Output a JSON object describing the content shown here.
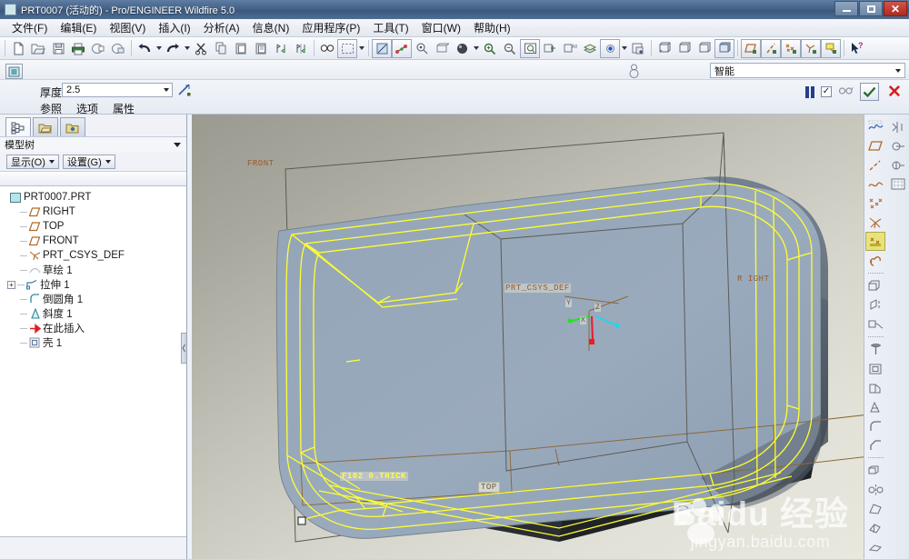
{
  "window": {
    "title": "PRT0007 (活动的) - Pro/ENGINEER Wildfire 5.0",
    "icon": "part-icon",
    "minimize": "—",
    "maximize": "□",
    "close": "✕"
  },
  "menubar": {
    "items": [
      {
        "label": "文件(F)",
        "name": "menu-file"
      },
      {
        "label": "编辑(E)",
        "name": "menu-edit"
      },
      {
        "label": "视图(V)",
        "name": "menu-view"
      },
      {
        "label": "插入(I)",
        "name": "menu-insert"
      },
      {
        "label": "分析(A)",
        "name": "menu-analysis"
      },
      {
        "label": "信息(N)",
        "name": "menu-info"
      },
      {
        "label": "应用程序(P)",
        "name": "menu-applications"
      },
      {
        "label": "工具(T)",
        "name": "menu-tools"
      },
      {
        "label": "窗口(W)",
        "name": "menu-window"
      },
      {
        "label": "帮助(H)",
        "name": "menu-help"
      }
    ]
  },
  "toolbar": {
    "items": [
      "new-file-icon",
      "open-file-icon",
      "save-icon",
      "print-icon",
      "mail-icon",
      "mail-review-icon",
      "undo-icon",
      "redo-icon",
      "cut-icon",
      "copy-icon",
      "paste-icon",
      "paste-special-icon",
      "regenerate-icon",
      "regenerate-all-icon",
      "find-icon",
      "select-box-icon",
      "sketcher-icon",
      "datum-display-icon",
      "spin-center-icon",
      "reorient-icon",
      "shading-icon",
      "zoom-in-icon",
      "zoom-out-icon",
      "refit-icon",
      "layer-icon",
      "annotation-icon",
      "appearance-icon",
      "light-icon",
      "saved-view-icon",
      "wireframe-icon",
      "hidden-line-icon",
      "no-hidden-icon",
      "shaded-icon",
      "datum-plane-toggle-icon",
      "datum-axis-toggle-icon",
      "datum-point-toggle-icon",
      "datum-csys-toggle-icon",
      "annotation-toggle-icon",
      "context-help-icon"
    ]
  },
  "filter": {
    "label_icon": "spin-center-icon",
    "value": "智能",
    "name": "selection-filter"
  },
  "dashboard": {
    "feature_icon": "shell-feature-icon",
    "thickness_label": "厚度",
    "thickness_value": "2.5",
    "flip_icon": "flip-direction-icon",
    "tabs": [
      {
        "label": "参照",
        "name": "dashboard-tab-references"
      },
      {
        "label": "选项",
        "name": "dashboard-tab-options"
      },
      {
        "label": "属性",
        "name": "dashboard-tab-properties"
      }
    ],
    "actions": {
      "pause": "pause-icon",
      "preview_checked": "✓",
      "preview_icon": "glasses-preview-icon",
      "confirm": "✓",
      "cancel": "✕"
    }
  },
  "left_panel": {
    "tabs": [
      {
        "name": "tab-model-tree",
        "icon": "model-tree-icon",
        "active": true
      },
      {
        "name": "tab-folder-browser",
        "icon": "folder-browser-icon",
        "active": false
      },
      {
        "name": "tab-favorites",
        "icon": "favorites-folder-icon",
        "active": false
      }
    ],
    "title": "模型树",
    "buttons": [
      {
        "label": "显示(O)",
        "name": "tree-show-button"
      },
      {
        "label": "设置(G)",
        "name": "tree-settings-button"
      }
    ],
    "tree": [
      {
        "label": "PRT0007.PRT",
        "icon": "part-icon",
        "depth": 0,
        "expand": ""
      },
      {
        "label": "RIGHT",
        "icon": "datum-plane-icon",
        "depth": 1,
        "expand": ""
      },
      {
        "label": "TOP",
        "icon": "datum-plane-icon",
        "depth": 1,
        "expand": ""
      },
      {
        "label": "FRONT",
        "icon": "datum-plane-icon",
        "depth": 1,
        "expand": ""
      },
      {
        "label": "PRT_CSYS_DEF",
        "icon": "datum-csys-icon",
        "depth": 1,
        "expand": ""
      },
      {
        "label": "草绘 1",
        "icon": "sketch-icon",
        "depth": 1,
        "expand": ""
      },
      {
        "label": "拉伸 1",
        "icon": "extrude-icon",
        "depth": 1,
        "expand": "+"
      },
      {
        "label": "倒圆角 1",
        "icon": "round-icon",
        "depth": 1,
        "expand": ""
      },
      {
        "label": "斜度 1",
        "icon": "draft-icon",
        "depth": 1,
        "expand": ""
      },
      {
        "label": "在此插入",
        "icon": "insert-here-icon",
        "depth": 1,
        "expand": ""
      },
      {
        "label": "壳 1",
        "icon": "shell-icon",
        "depth": 1,
        "expand": ""
      }
    ]
  },
  "viewport": {
    "labels": {
      "front_plane": "FRONT",
      "right_plane": "R IGHT",
      "top_plane": "TOP",
      "csys": "PRT_CSYS_DEF",
      "axis_x": "X",
      "axis_y": "Y",
      "axis_z": "Z",
      "dimension": "F102 0.THICK"
    },
    "colors": {
      "preview_wireframe": "#ffff2e",
      "datum_plane": "#8a6a3a",
      "model_surface": "#8fa0b4",
      "model_dark": "#2a2d33",
      "axis_x": "#e61f1f",
      "axis_y": "#1fe61f",
      "axis_z": "#1fd8e6"
    }
  },
  "watermark": {
    "main": "Baidu 经验",
    "sub": "jingyan.baidu.com"
  },
  "right_toolbar": {
    "column_a": [
      "sketch-tool-icon",
      "datum-plane-tool-icon",
      "datum-axis-tool-icon",
      "datum-curve-tool-icon",
      "datum-point-tool-icon",
      "datum-coord-sys-tool-icon",
      "datum-point-offset-icon",
      "datum-ref-icon",
      "extrude-tool-icon",
      "revolve-tool-icon",
      "sweep-tool-icon",
      "hole-tool-icon",
      "shell-tool-icon",
      "rib-tool-icon",
      "draft-tool-icon",
      "round-tool-icon",
      "chamfer-tool-icon",
      "pattern-tool-icon",
      "mirror-tool-icon",
      "trim-tool-icon",
      "merge-tool-icon",
      "offset-tool-icon"
    ],
    "column_b": [
      "measure-icon",
      "analysis-icon",
      "model-analysis-icon",
      "grid-icon"
    ]
  }
}
